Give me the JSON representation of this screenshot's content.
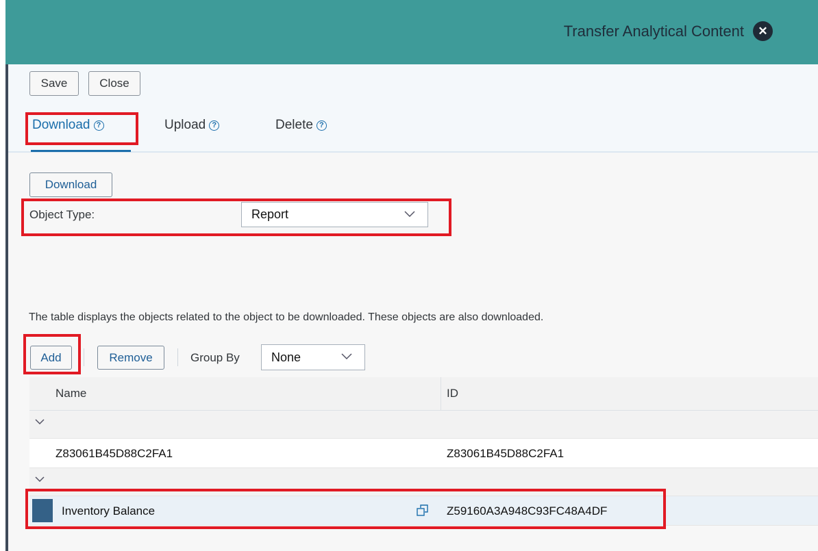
{
  "header": {
    "title": "Transfer Analytical Content",
    "close_icon": "close-circle-icon",
    "color": "#3e9b99"
  },
  "toolbar": {
    "save_label": "Save",
    "close_label": "Close"
  },
  "tabs": [
    {
      "label": "Download",
      "active": true
    },
    {
      "label": "Upload",
      "active": false
    },
    {
      "label": "Delete",
      "active": false
    }
  ],
  "download_panel": {
    "download_button": "Download",
    "object_type_label": "Object Type:",
    "object_type_value": "Report",
    "description": "The table displays the objects related to the object to be downloaded. These objects are also downloaded."
  },
  "table_toolbar": {
    "add_label": "Add",
    "remove_label": "Remove",
    "group_by_label": "Group By",
    "group_by_value": "None"
  },
  "table": {
    "columns": [
      "Name",
      "ID"
    ],
    "groups": [
      {
        "rows": [
          {
            "name": "Z83061B45D88C2FA1",
            "id": "Z83061B45D88C2FA1",
            "selected": false
          }
        ]
      },
      {
        "rows": [
          {
            "name": "Inventory Balance",
            "id": "Z59160A3A948C93FC48A4DF",
            "selected": true
          }
        ]
      }
    ]
  },
  "highlight_color": "#e11a24"
}
